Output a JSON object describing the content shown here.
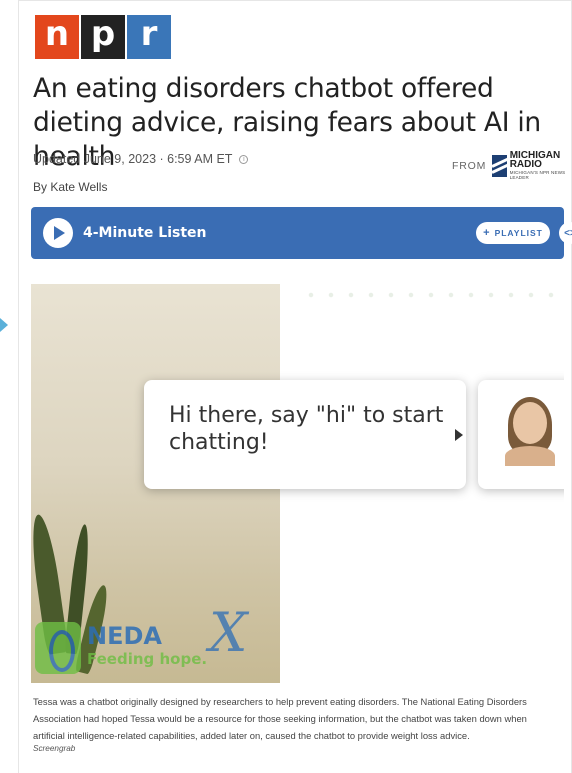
{
  "logo": {
    "letters": [
      "n",
      "p",
      "r"
    ]
  },
  "article": {
    "headline": "An eating disorders chatbot offered dieting advice, raising fears about AI in health",
    "updated": "Updated June 9, 2023 · 6:59 AM ET",
    "from_label": "FROM",
    "station_name_line1": "MICHIGAN",
    "station_name_line2": "RADIO",
    "station_tagline": "MICHIGAN'S NPR NEWS LEADER",
    "byline": "By Kate Wells"
  },
  "player": {
    "listen_label": "4-Minute Listen",
    "playlist_label": "PLAYLIST",
    "embed_symbol": "<>"
  },
  "image": {
    "chat_text": "Hi there, say \"hi\" to start chatting!",
    "neda_name": "NEDA",
    "neda_tagline": "Feeding hope.",
    "x_mark": "X"
  },
  "caption": {
    "text": "Tessa was a chatbot originally designed by researchers to help prevent eating disorders. The National Eating Disorders Association had hoped Tessa would be a resource for those seeking information, but the chatbot was taken down when artificial intelligence-related capabilities, added later on, caused the chatbot to provide weight loss advice.",
    "credit": "Screengrab"
  },
  "colors": {
    "npr_red": "#e3471c",
    "npr_black": "#222222",
    "npr_blue": "#3a76b8",
    "player_blue": "#3a6db4"
  }
}
